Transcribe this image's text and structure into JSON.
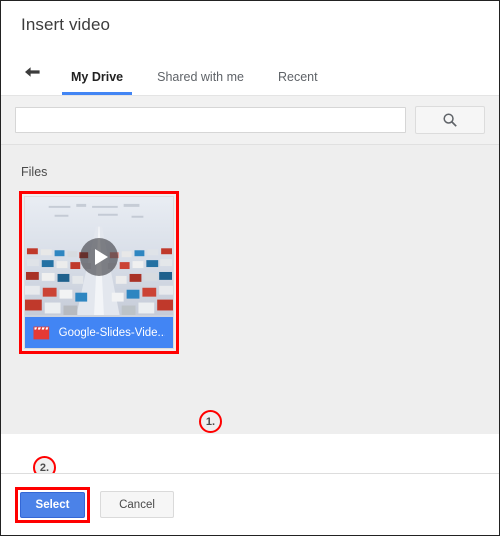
{
  "dialog": {
    "title": "Insert video"
  },
  "nav": {
    "back_icon": "back-arrow-icon",
    "tabs": [
      {
        "label": "My Drive",
        "active": true
      },
      {
        "label": "Shared with me",
        "active": false
      },
      {
        "label": "Recent",
        "active": false
      }
    ]
  },
  "search": {
    "value": "",
    "placeholder": "",
    "button_icon": "search-icon"
  },
  "files": {
    "section_label": "Files",
    "items": [
      {
        "name": "Google-Slides-Vide...",
        "type_icon": "film-clapperboard-icon",
        "play_icon": "play-icon",
        "selected": true
      }
    ]
  },
  "annotations": [
    {
      "id": "1",
      "label": "1."
    },
    {
      "id": "2",
      "label": "2."
    }
  ],
  "footer": {
    "select_label": "Select",
    "cancel_label": "Cancel"
  },
  "colors": {
    "accent": "#4285f4",
    "marker": "#ff0000",
    "primary_button": "#4b82e8",
    "file_label_bg": "#4285f4",
    "film_icon": "#e53935"
  }
}
